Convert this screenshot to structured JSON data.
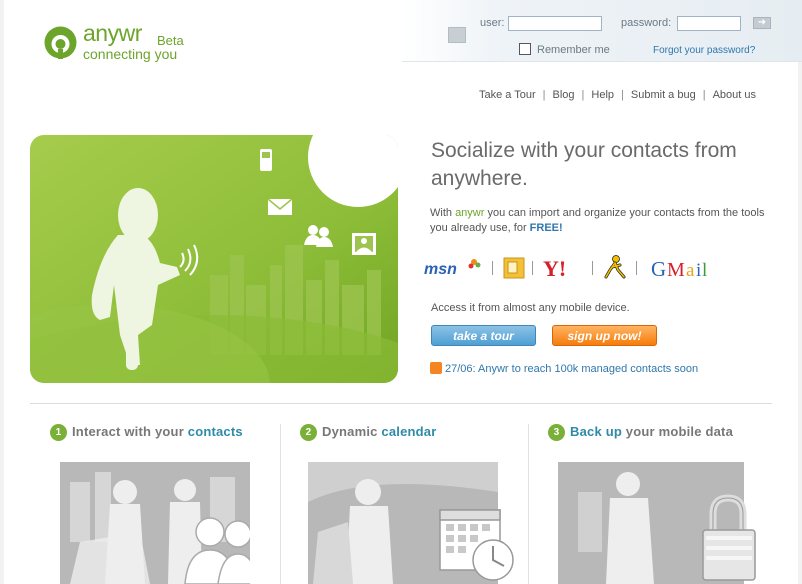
{
  "brand": {
    "name": "anywr",
    "badge": "Beta",
    "tagline": "connecting you",
    "color": "#6da42c"
  },
  "login": {
    "user_label": "user:",
    "password_label": "password:",
    "user_value": "",
    "password_value": "",
    "remember_label": "Remember me",
    "forgot_label": "Forgot your password?",
    "submit_icon": "arrow-right-icon"
  },
  "nav": {
    "items": [
      "Take a Tour",
      "Blog",
      "Help",
      "Submit a bug",
      "About us"
    ],
    "separator": "|"
  },
  "hero": {
    "headline": "Socialize with your contacts from anywhere.",
    "intro_prefix": "With ",
    "intro_brand": "anywr",
    "intro_middle": " you can import and organize your contacts from the tools you already use, for ",
    "intro_free": "FREE!",
    "services": [
      "msn",
      "outlook",
      "yahoo",
      "aim",
      "gmail"
    ],
    "mobile_text": "Access it from almost any mobile device.",
    "tour_button": "take a tour",
    "signup_button": "sign up now!",
    "news": "27/06: Anywr to reach 100k managed contacts soon",
    "hero_icons": [
      "mobile-phone-icon",
      "envelope-icon",
      "contacts-icon",
      "photo-icon",
      "wifi-signal-icon"
    ]
  },
  "features": [
    {
      "num": "1",
      "prefix": "Interact with your ",
      "highlight": "contacts",
      "suffix": "",
      "image": "people-crowd-image"
    },
    {
      "num": "2",
      "prefix": "Dynamic ",
      "highlight": "calendar",
      "suffix": "",
      "image": "calendar-clock-image"
    },
    {
      "num": "3",
      "prefix": "",
      "highlight": "Back up",
      "suffix": " your mobile data",
      "image": "padlock-image"
    }
  ],
  "colors": {
    "accent_blue": "#2f78ad",
    "tour_button": "#4f9fd3",
    "signup_button": "#f67c0b",
    "hero_green": "#8fbf3a"
  }
}
